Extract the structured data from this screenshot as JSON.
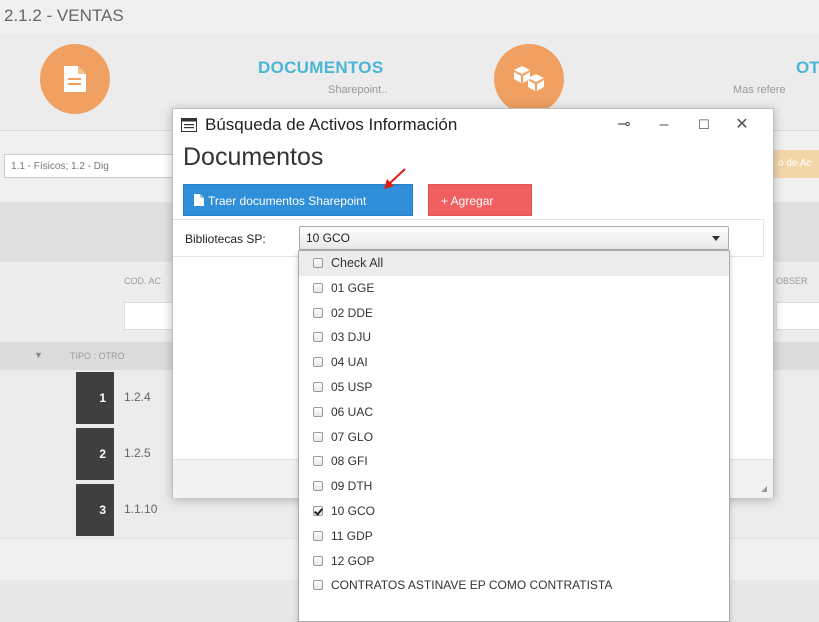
{
  "background": {
    "section_title": "2.1.2 - VENTAS",
    "documentos_title": "DOCUMENTOS",
    "documentos_sub": "Sharepoint..",
    "otros_title": "OT",
    "otros_sub": "Mas refere",
    "filter_value": "1.1 - Físicos; 1.2 - Dig",
    "right_button": "o de Ac",
    "col_cod": "COD. AC",
    "col_obs": "OBSER",
    "tipo_label": "TIPO : OTRO",
    "rows": [
      {
        "num": "1",
        "code": "1.2.4"
      },
      {
        "num": "2",
        "code": "1.2.5"
      },
      {
        "num": "3",
        "code": "1.1.10"
      }
    ],
    "accent_orange": "#f0a060",
    "accent_blue": "#4ab6d6"
  },
  "dialog": {
    "title": "Búsqueda de Activos Información",
    "heading": "Documentos",
    "controls": {
      "pin": "⊸",
      "minimize": "–",
      "maximize": "☐",
      "close": "✕"
    },
    "traer_button": "Traer documentos Sharepoint",
    "agregar_button": "+ Agregar",
    "bibliotecas_label": "Bibliotecas SP:",
    "selected_library": "10 GCO",
    "button_blue": "#2f8fd8",
    "button_red": "#f06060"
  },
  "dropdown": {
    "options": [
      {
        "label": "Check All",
        "checked": false
      },
      {
        "label": "01 GGE",
        "checked": false
      },
      {
        "label": "02 DDE",
        "checked": false
      },
      {
        "label": "03 DJU",
        "checked": false
      },
      {
        "label": "04 UAI",
        "checked": false
      },
      {
        "label": "05 USP",
        "checked": false
      },
      {
        "label": "06 UAC",
        "checked": false
      },
      {
        "label": "07 GLO",
        "checked": false
      },
      {
        "label": "08 GFI",
        "checked": false
      },
      {
        "label": "09 DTH",
        "checked": false
      },
      {
        "label": "10 GCO",
        "checked": true
      },
      {
        "label": "11 GDP",
        "checked": false
      },
      {
        "label": "12 GOP",
        "checked": false
      },
      {
        "label": "CONTRATOS ASTINAVE EP COMO CONTRATISTA",
        "checked": false
      }
    ]
  }
}
